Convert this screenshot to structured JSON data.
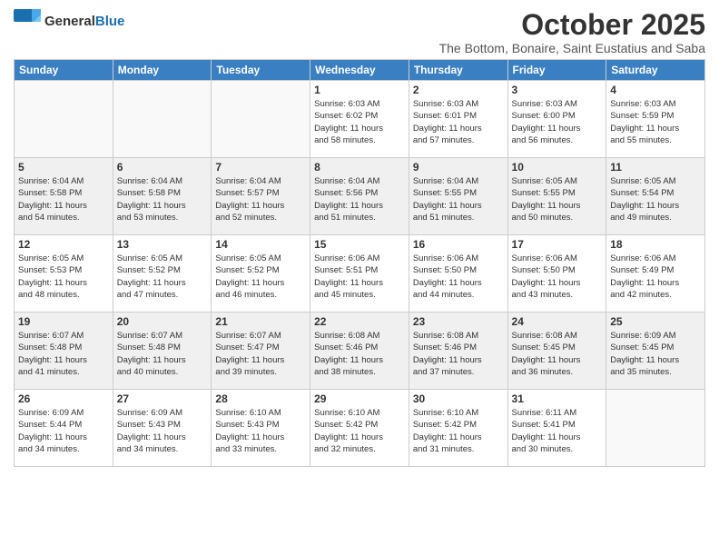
{
  "logo": {
    "general": "General",
    "blue": "Blue"
  },
  "title": "October 2025",
  "location": "The Bottom, Bonaire, Saint Eustatius and Saba",
  "weekdays": [
    "Sunday",
    "Monday",
    "Tuesday",
    "Wednesday",
    "Thursday",
    "Friday",
    "Saturday"
  ],
  "weeks": [
    [
      {
        "day": "",
        "info": ""
      },
      {
        "day": "",
        "info": ""
      },
      {
        "day": "",
        "info": ""
      },
      {
        "day": "1",
        "info": "Sunrise: 6:03 AM\nSunset: 6:02 PM\nDaylight: 11 hours\nand 58 minutes."
      },
      {
        "day": "2",
        "info": "Sunrise: 6:03 AM\nSunset: 6:01 PM\nDaylight: 11 hours\nand 57 minutes."
      },
      {
        "day": "3",
        "info": "Sunrise: 6:03 AM\nSunset: 6:00 PM\nDaylight: 11 hours\nand 56 minutes."
      },
      {
        "day": "4",
        "info": "Sunrise: 6:03 AM\nSunset: 5:59 PM\nDaylight: 11 hours\nand 55 minutes."
      }
    ],
    [
      {
        "day": "5",
        "info": "Sunrise: 6:04 AM\nSunset: 5:58 PM\nDaylight: 11 hours\nand 54 minutes."
      },
      {
        "day": "6",
        "info": "Sunrise: 6:04 AM\nSunset: 5:58 PM\nDaylight: 11 hours\nand 53 minutes."
      },
      {
        "day": "7",
        "info": "Sunrise: 6:04 AM\nSunset: 5:57 PM\nDaylight: 11 hours\nand 52 minutes."
      },
      {
        "day": "8",
        "info": "Sunrise: 6:04 AM\nSunset: 5:56 PM\nDaylight: 11 hours\nand 51 minutes."
      },
      {
        "day": "9",
        "info": "Sunrise: 6:04 AM\nSunset: 5:55 PM\nDaylight: 11 hours\nand 51 minutes."
      },
      {
        "day": "10",
        "info": "Sunrise: 6:05 AM\nSunset: 5:55 PM\nDaylight: 11 hours\nand 50 minutes."
      },
      {
        "day": "11",
        "info": "Sunrise: 6:05 AM\nSunset: 5:54 PM\nDaylight: 11 hours\nand 49 minutes."
      }
    ],
    [
      {
        "day": "12",
        "info": "Sunrise: 6:05 AM\nSunset: 5:53 PM\nDaylight: 11 hours\nand 48 minutes."
      },
      {
        "day": "13",
        "info": "Sunrise: 6:05 AM\nSunset: 5:52 PM\nDaylight: 11 hours\nand 47 minutes."
      },
      {
        "day": "14",
        "info": "Sunrise: 6:05 AM\nSunset: 5:52 PM\nDaylight: 11 hours\nand 46 minutes."
      },
      {
        "day": "15",
        "info": "Sunrise: 6:06 AM\nSunset: 5:51 PM\nDaylight: 11 hours\nand 45 minutes."
      },
      {
        "day": "16",
        "info": "Sunrise: 6:06 AM\nSunset: 5:50 PM\nDaylight: 11 hours\nand 44 minutes."
      },
      {
        "day": "17",
        "info": "Sunrise: 6:06 AM\nSunset: 5:50 PM\nDaylight: 11 hours\nand 43 minutes."
      },
      {
        "day": "18",
        "info": "Sunrise: 6:06 AM\nSunset: 5:49 PM\nDaylight: 11 hours\nand 42 minutes."
      }
    ],
    [
      {
        "day": "19",
        "info": "Sunrise: 6:07 AM\nSunset: 5:48 PM\nDaylight: 11 hours\nand 41 minutes."
      },
      {
        "day": "20",
        "info": "Sunrise: 6:07 AM\nSunset: 5:48 PM\nDaylight: 11 hours\nand 40 minutes."
      },
      {
        "day": "21",
        "info": "Sunrise: 6:07 AM\nSunset: 5:47 PM\nDaylight: 11 hours\nand 39 minutes."
      },
      {
        "day": "22",
        "info": "Sunrise: 6:08 AM\nSunset: 5:46 PM\nDaylight: 11 hours\nand 38 minutes."
      },
      {
        "day": "23",
        "info": "Sunrise: 6:08 AM\nSunset: 5:46 PM\nDaylight: 11 hours\nand 37 minutes."
      },
      {
        "day": "24",
        "info": "Sunrise: 6:08 AM\nSunset: 5:45 PM\nDaylight: 11 hours\nand 36 minutes."
      },
      {
        "day": "25",
        "info": "Sunrise: 6:09 AM\nSunset: 5:45 PM\nDaylight: 11 hours\nand 35 minutes."
      }
    ],
    [
      {
        "day": "26",
        "info": "Sunrise: 6:09 AM\nSunset: 5:44 PM\nDaylight: 11 hours\nand 34 minutes."
      },
      {
        "day": "27",
        "info": "Sunrise: 6:09 AM\nSunset: 5:43 PM\nDaylight: 11 hours\nand 34 minutes."
      },
      {
        "day": "28",
        "info": "Sunrise: 6:10 AM\nSunset: 5:43 PM\nDaylight: 11 hours\nand 33 minutes."
      },
      {
        "day": "29",
        "info": "Sunrise: 6:10 AM\nSunset: 5:42 PM\nDaylight: 11 hours\nand 32 minutes."
      },
      {
        "day": "30",
        "info": "Sunrise: 6:10 AM\nSunset: 5:42 PM\nDaylight: 11 hours\nand 31 minutes."
      },
      {
        "day": "31",
        "info": "Sunrise: 6:11 AM\nSunset: 5:41 PM\nDaylight: 11 hours\nand 30 minutes."
      },
      {
        "day": "",
        "info": ""
      }
    ]
  ]
}
